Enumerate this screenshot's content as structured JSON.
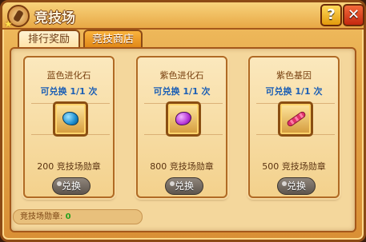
{
  "window": {
    "title": "竞技场"
  },
  "header": {
    "help_label": "?",
    "close_label": "✕"
  },
  "tabs": [
    {
      "label": "排行奖励",
      "active": false
    },
    {
      "label": "竞技商店",
      "active": true
    }
  ],
  "shop": {
    "items": [
      {
        "name": "蓝色进化石",
        "limit": "可兑换 1/1 次",
        "price": "200 竞技场勋章",
        "button": "兑换",
        "icon": "blue-evolution-stone-icon"
      },
      {
        "name": "紫色进化石",
        "limit": "可兑换 1/1 次",
        "price": "800 竞技场勋章",
        "button": "兑换",
        "icon": "purple-evolution-stone-icon"
      },
      {
        "name": "紫色基因",
        "limit": "可兑换 1/1 次",
        "price": "500 竞技场勋章",
        "button": "兑换",
        "icon": "purple-gene-icon"
      }
    ]
  },
  "status": {
    "label": "竞技场勋章:",
    "value": "0"
  },
  "colors": {
    "limit_text": "#1c5fb5",
    "status_value": "#27a11f",
    "frame": "#8c4a15"
  }
}
